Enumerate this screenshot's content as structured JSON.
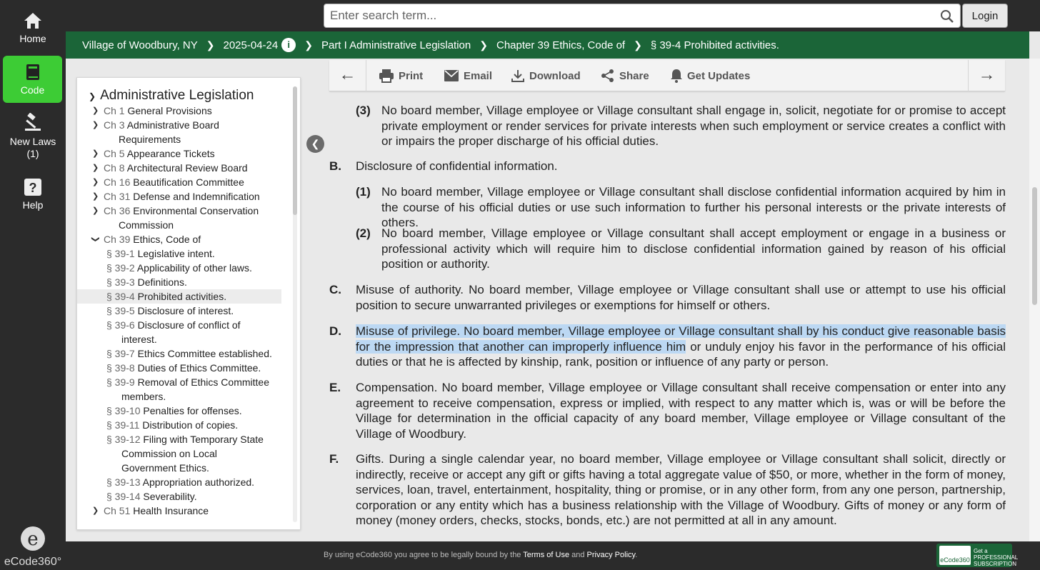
{
  "rail": {
    "items": [
      {
        "label": "Home"
      },
      {
        "label": "Code"
      },
      {
        "label": "New Laws"
      },
      {
        "label": "(1)"
      },
      {
        "label": "Help"
      }
    ],
    "brand": "eCode360°"
  },
  "search": {
    "placeholder": "Enter search term...",
    "login": "Login"
  },
  "breadcrumb": [
    "Village of Woodbury, NY",
    "2025-04-24",
    "Part I Administrative Legislation",
    "Chapter 39 Ethics, Code of",
    "§ 39-4 Prohibited activities."
  ],
  "toolbar": {
    "print": "Print",
    "email": "Email",
    "download": "Download",
    "share": "Share",
    "updates": "Get Updates"
  },
  "toc": {
    "title": "Administrative Legislation",
    "chapters": [
      {
        "num": "Ch 1",
        "name": "General Provisions"
      },
      {
        "num": "Ch 3",
        "name": "Administrative Board",
        "cont": "Requirements"
      },
      {
        "num": "Ch 5",
        "name": "Appearance Tickets"
      },
      {
        "num": "Ch 8",
        "name": "Architectural Review Board"
      },
      {
        "num": "Ch 16",
        "name": "Beautification Committee"
      },
      {
        "num": "Ch 31",
        "name": "Defense and Indemnification"
      },
      {
        "num": "Ch 36",
        "name": "Environmental Conservation",
        "cont": "Commission"
      },
      {
        "num": "Ch 39",
        "name": "Ethics, Code of"
      }
    ],
    "sections": [
      {
        "num": "§ 39-1",
        "name": "Legislative intent."
      },
      {
        "num": "§ 39-2",
        "name": "Applicability of other laws."
      },
      {
        "num": "§ 39-3",
        "name": "Definitions."
      },
      {
        "num": "§ 39-4",
        "name": "Prohibited activities."
      },
      {
        "num": "§ 39-5",
        "name": "Disclosure of interest."
      },
      {
        "num": "§ 39-6",
        "name": "Disclosure of conflict of",
        "cont": "interest."
      },
      {
        "num": "§ 39-7",
        "name": "Ethics Committee established."
      },
      {
        "num": "§ 39-8",
        "name": "Duties of Ethics Committee."
      },
      {
        "num": "§ 39-9",
        "name": "Removal of Ethics Committee",
        "cont": "members."
      },
      {
        "num": "§ 39-10",
        "name": "Penalties for offenses."
      },
      {
        "num": "§ 39-11",
        "name": "Distribution of copies."
      },
      {
        "num": "§ 39-12",
        "name": "Filing with Temporary State",
        "cont": "Commission on Local",
        "cont2": "Government Ethics."
      },
      {
        "num": "§ 39-13",
        "name": "Appropriation authorized."
      },
      {
        "num": "§ 39-14",
        "name": "Severability."
      }
    ],
    "last": {
      "num": "Ch 51",
      "name": "Health Insurance"
    }
  },
  "content": {
    "a3": {
      "label": "(3)",
      "text": "No board member, Village employee or Village consultant shall engage in, solicit, negotiate for or promise to accept private employment or render services for private interests when such employment or service creates a conflict with or impairs the proper discharge of his official duties."
    },
    "b": {
      "label": "B.",
      "text": "Disclosure of confidential information."
    },
    "b1": {
      "label": "(1)",
      "text": "No board member, Village employee or Village consultant shall disclose confidential information acquired by him in the course of his official duties or use such information to further his personal interests or the private interests of others."
    },
    "b2": {
      "label": "(2)",
      "text": "No board member, Village employee or Village consultant shall accept employment or engage in a business or professional activity which will require him to disclose confidential information gained by reason of his official position or authority."
    },
    "c": {
      "label": "C.",
      "text": "Misuse of authority. No board member, Village employee or Village consultant shall use or attempt to use his official position to secure unwarranted privileges or exemptions for himself or others."
    },
    "d": {
      "label": "D.",
      "highlighted": "Misuse of privilege. No board member, Village employee or Village consultant shall by his conduct give reasonable basis for the impression that another can improperly influence him",
      "rest": " or unduly enjoy his favor in the performance of his official duties or that he is affected by kinship, rank, position or influence of any party or person."
    },
    "e": {
      "label": "E.",
      "text": "Compensation. No board member, Village employee or Village consultant shall receive compensation or enter into any agreement to receive compensation, express or implied, with respect to any matter which is, was or will be before the Village for determination in the official capacity of any board member, Village employee or Village consultant of the Village of Woodbury."
    },
    "f": {
      "label": "F.",
      "text": "Gifts. During a single calendar year, no board member, Village employee or Village consultant shall solicit, directly or indirectly, receive or accept any gift or gifts having a total aggregate value of $50, or more, whether in the form of money, services, loan, travel, entertainment, hospitality, thing or promise, or in any other form, from any one person, partnership, corporation or any entity which has a business relationship with the Village of Woodbury. Gifts of money or any form of money (money orders, checks, stocks, bonds, etc.) are not permitted at all in any amount."
    }
  },
  "footer": {
    "pre": "By using eCode360 you agree to be legally bound by the ",
    "terms": "Terms of Use",
    "and": " and ",
    "privacy": "Privacy Policy",
    "end": ".",
    "sub_line1": "Get a",
    "sub_line2": "PROFESSIONAL",
    "sub_line3": "SUBSCRIPTION",
    "sub_logo": "eCode360"
  },
  "colors": {
    "green": "#1b6538",
    "active": "#3dcc35",
    "highlight": "#bcd8f3",
    "rail": "#2b2b2b"
  }
}
